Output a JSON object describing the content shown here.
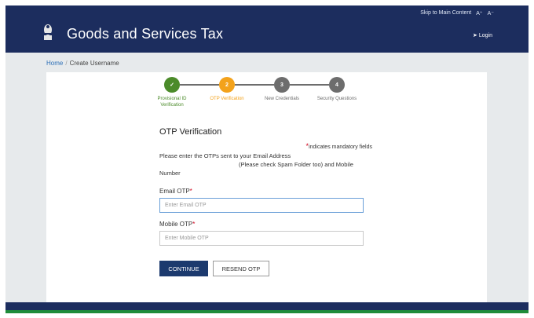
{
  "topbar": {
    "skip_link": "Skip to Main Content",
    "font_increase": "A⁺",
    "font_decrease": "A⁻"
  },
  "header": {
    "brand_title": "Goods and Services Tax",
    "login_label": "Login",
    "emblem_icon": "national-emblem-icon"
  },
  "breadcrumb": {
    "home": "Home",
    "separator": "/",
    "current": "Create Username"
  },
  "stepper": {
    "steps": [
      {
        "number": "✓",
        "label_line1": "Provisional ID",
        "label_line2": "Verification",
        "state": "done",
        "color": "#4b8b2a"
      },
      {
        "number": "2",
        "label_line1": "OTP Verification",
        "label_line2": "",
        "state": "active",
        "color": "#f3a21b"
      },
      {
        "number": "3",
        "label_line1": "New Credentials",
        "label_line2": "",
        "state": "pending",
        "color": "#6d6d6d"
      },
      {
        "number": "4",
        "label_line1": "Security Questions",
        "label_line2": "",
        "state": "pending",
        "color": "#6d6d6d"
      }
    ]
  },
  "form": {
    "title": "OTP Verification",
    "mandatory_note": "indicates mandatory fields",
    "instruction_line1": "Please enter the OTPs sent to your Email Address",
    "instruction_line2": "(Please check Spam Folder too) and Mobile",
    "instruction_line3": "Number",
    "email_label": "Email OTP",
    "email_placeholder": "Enter Email OTP",
    "mobile_label": "Mobile OTP",
    "mobile_placeholder": "Enter Mobile OTP",
    "required_marker": "*",
    "continue_label": "CONTINUE",
    "resend_label": "RESEND OTP"
  },
  "colors": {
    "header_bg": "#1c2d5e",
    "primary_button": "#1c3a6e",
    "required": "#d0021b",
    "footer_green": "#1e8c3a"
  }
}
